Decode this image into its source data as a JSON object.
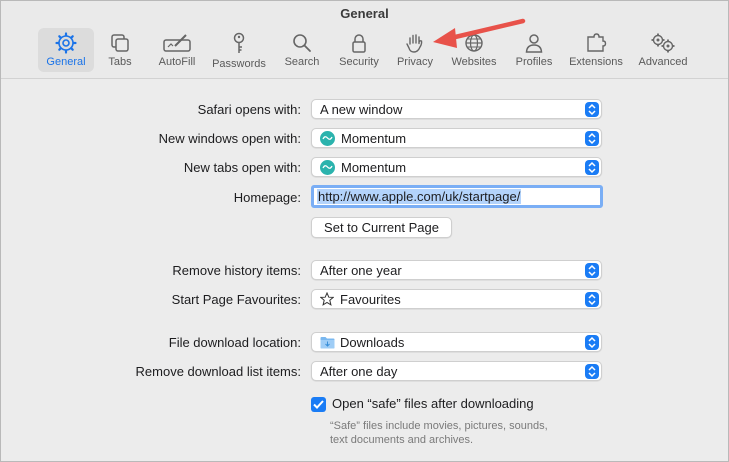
{
  "window": {
    "title": "General"
  },
  "tabs": [
    {
      "label": "General",
      "icon": "gear-icon",
      "active": true
    },
    {
      "label": "Tabs",
      "icon": "tabs-icon"
    },
    {
      "label": "AutoFill",
      "icon": "autofill-icon"
    },
    {
      "label": "Passwords",
      "icon": "key-icon"
    },
    {
      "label": "Search",
      "icon": "search-icon"
    },
    {
      "label": "Security",
      "icon": "lock-icon"
    },
    {
      "label": "Privacy",
      "icon": "hand-icon"
    },
    {
      "label": "Websites",
      "icon": "globe-icon"
    },
    {
      "label": "Profiles",
      "icon": "person-icon"
    },
    {
      "label": "Extensions",
      "icon": "puzzle-icon"
    },
    {
      "label": "Advanced",
      "icon": "gears-icon"
    }
  ],
  "settings": {
    "safari_opens_with": {
      "label": "Safari opens with:",
      "value": "A new window"
    },
    "new_windows_open_with": {
      "label": "New windows open with:",
      "value": "Momentum"
    },
    "new_tabs_open_with": {
      "label": "New tabs open with:",
      "value": "Momentum"
    },
    "homepage": {
      "label": "Homepage:",
      "value": "http://www.apple.com/uk/startpage/"
    },
    "set_current_page": {
      "label": "Set to Current Page"
    },
    "remove_history": {
      "label": "Remove history items:",
      "value": "After one year"
    },
    "start_page_favourites": {
      "label": "Start Page Favourites:",
      "value": "Favourites"
    },
    "file_download_location": {
      "label": "File download location:",
      "value": "Downloads"
    },
    "remove_download_list": {
      "label": "Remove download list items:",
      "value": "After one day"
    },
    "open_safe_files": {
      "label": "Open “safe” files after downloading",
      "checked": true
    },
    "safe_note_line1": "“Safe” files include movies, pictures, sounds,",
    "safe_note_line2": "text documents and archives."
  },
  "colors": {
    "accent": "#1a7cf5",
    "arrow": "#e8524a",
    "momentum": "#2bb3ad"
  }
}
